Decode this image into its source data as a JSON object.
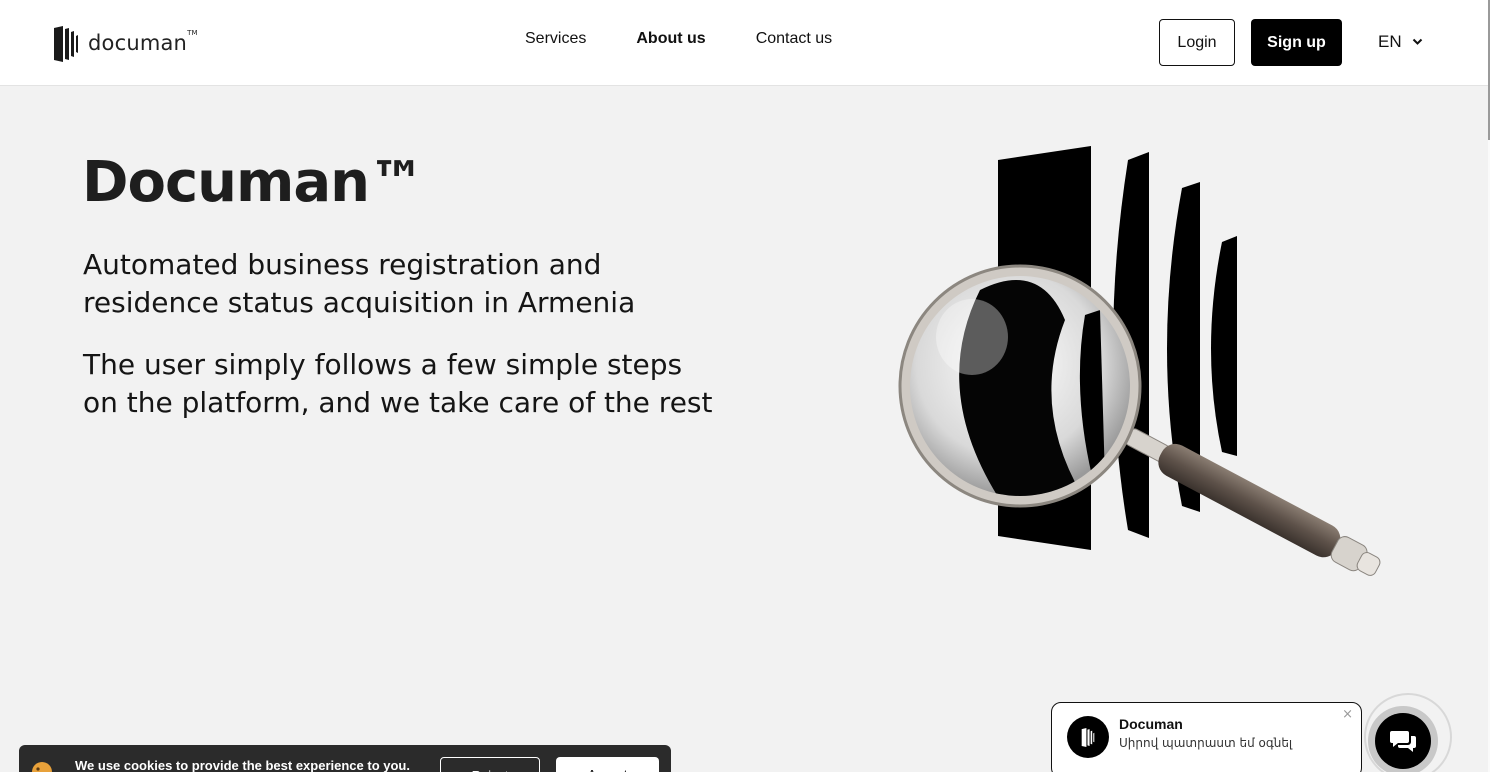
{
  "header": {
    "logo_text": "documan",
    "logo_tm": "TM",
    "nav": [
      {
        "label": "Services"
      },
      {
        "label": "About us"
      },
      {
        "label": "Contact us"
      }
    ],
    "login_label": "Login",
    "signup_label": "Sign up",
    "language": "EN"
  },
  "hero": {
    "title": "Documan™",
    "subtitle": "Automated business registration and residence status acquisition in Armenia",
    "description": "The user simply follows a few simple steps on the platform, and we take care of the rest"
  },
  "cookie_banner": {
    "text": "We use cookies to provide the best experience to you.",
    "reject_label": "Reject",
    "accept_label": "Accept"
  },
  "chat": {
    "name": "Documan",
    "message": "Սիրով պատրաստ եմ օգնել",
    "close": "×"
  },
  "colors": {
    "background": "#f2f2f2",
    "header": "#ffffff",
    "primary": "#000000"
  },
  "icons": {
    "logo": "documan-logo-icon",
    "lang": "chevron-down-icon",
    "illustration": "magnifier-bars-illustration",
    "cookie": "cookie-icon",
    "chat": "chat-bubbles-icon"
  }
}
